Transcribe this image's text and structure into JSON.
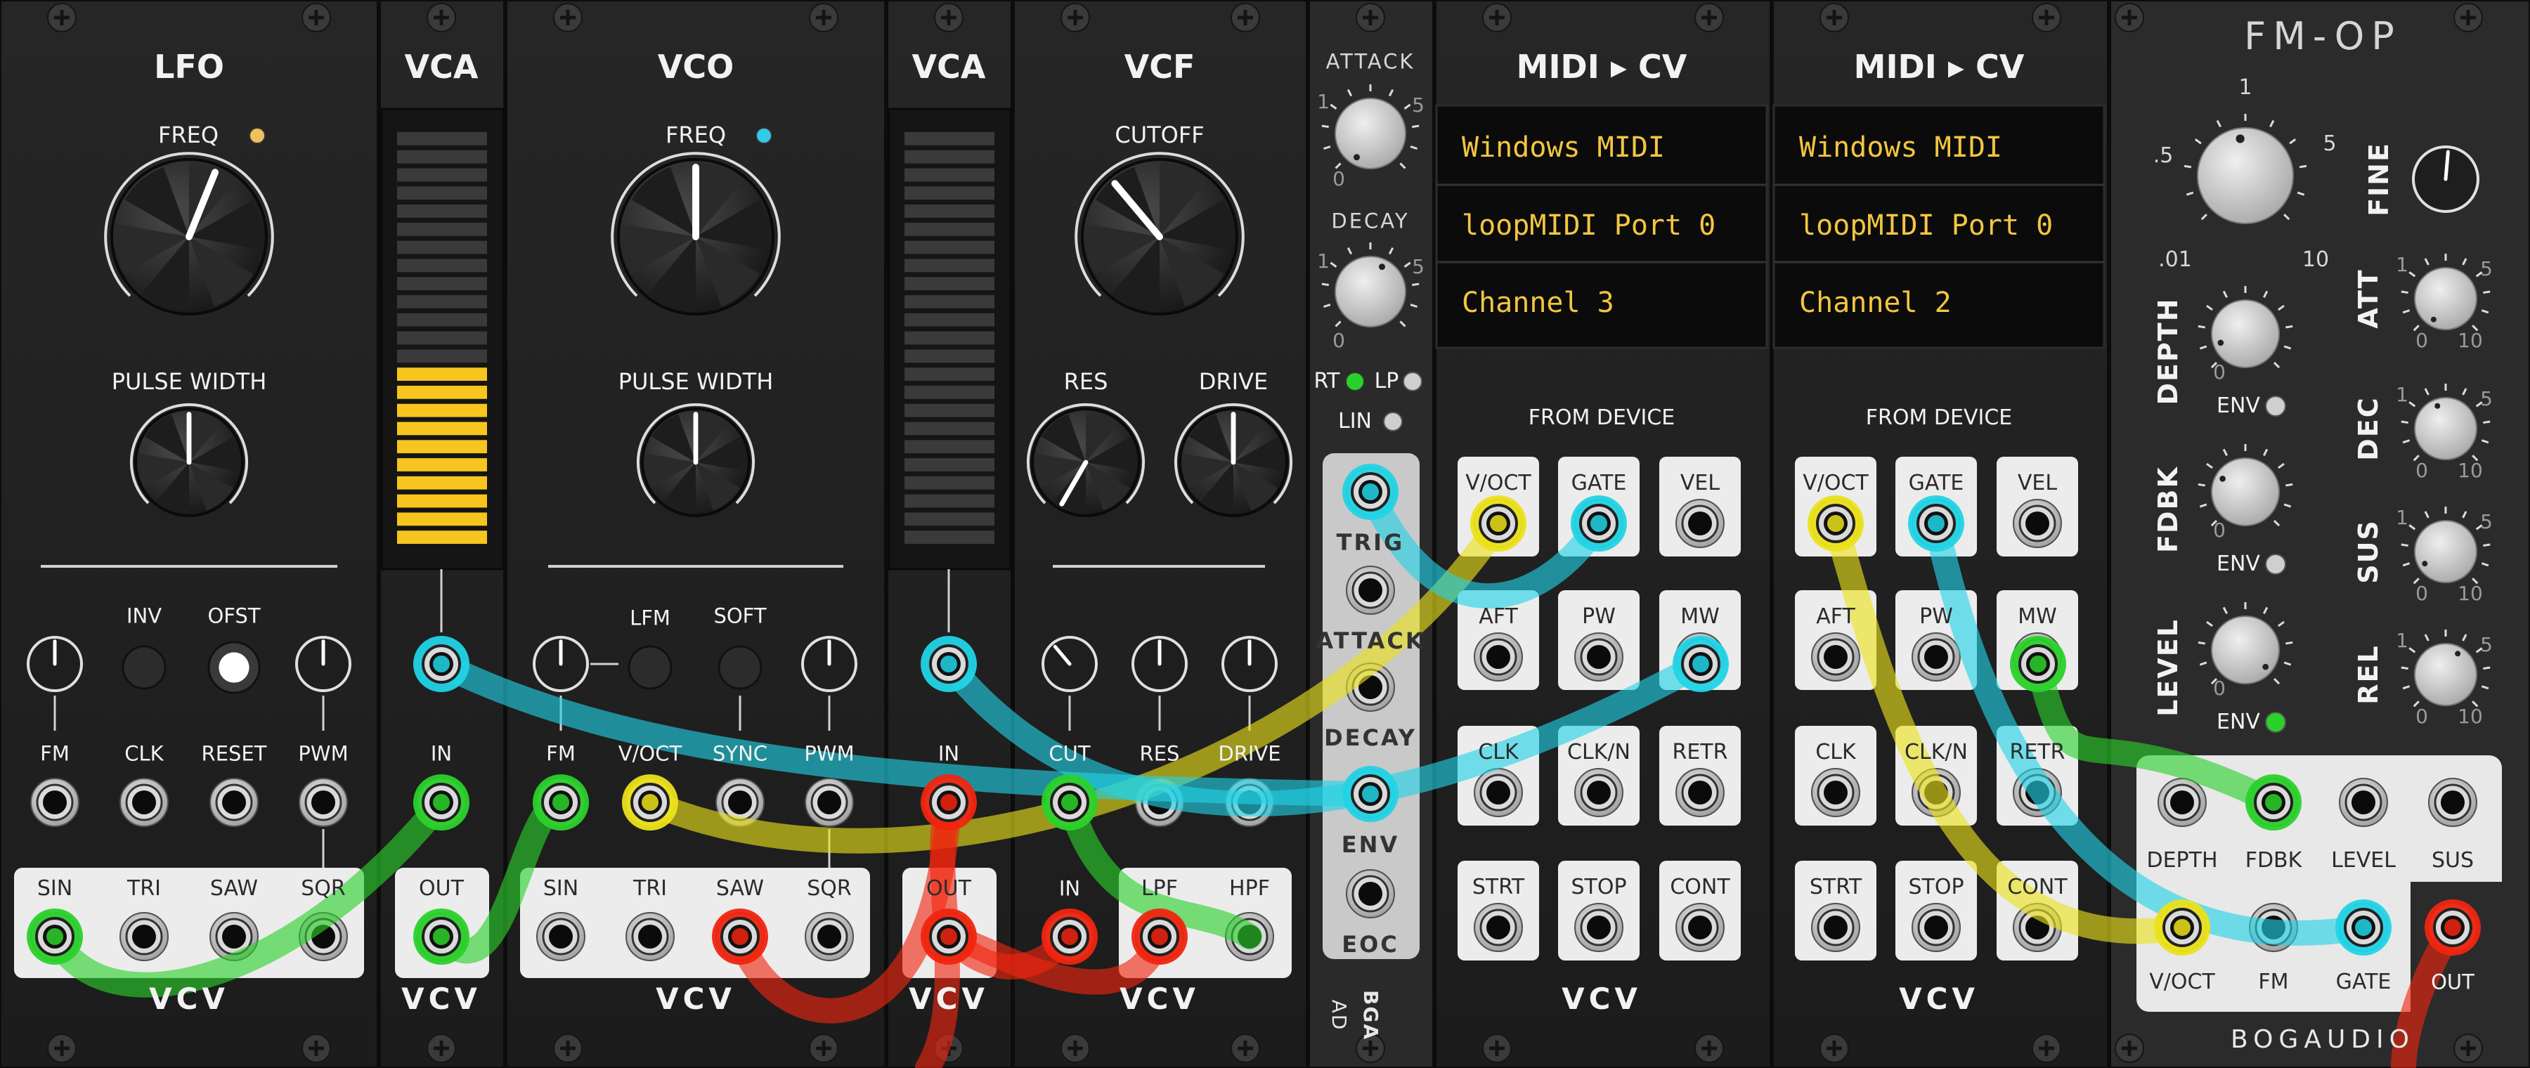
{
  "modules": {
    "lfo": {
      "title": "LFO",
      "freq_label": "FREQ",
      "pw_label": "PULSE WIDTH",
      "inv": "INV",
      "ofst": "OFST",
      "inputs": [
        "FM",
        "CLK",
        "RESET",
        "PWM"
      ],
      "outputs": [
        "SIN",
        "TRI",
        "SAW",
        "SQR"
      ],
      "freq_light_color": "#f0c060",
      "brand": "VCV"
    },
    "vca1": {
      "title": "VCA",
      "in": "IN",
      "out": "OUT",
      "brand": "VCV",
      "meter_color": "#f7c51e",
      "meter_level_pct": 45
    },
    "vco": {
      "title": "VCO",
      "freq_label": "FREQ",
      "pw_label": "PULSE WIDTH",
      "lfm": "LFM",
      "soft": "SOFT",
      "inputs": [
        "FM",
        "V/OCT",
        "SYNC",
        "PWM"
      ],
      "outputs": [
        "SIN",
        "TRI",
        "SAW",
        "SQR"
      ],
      "freq_light_color": "#35c9e8",
      "brand": "VCV"
    },
    "vca2": {
      "title": "VCA",
      "in": "IN",
      "out": "OUT",
      "brand": "VCV",
      "meter_level_pct": 0
    },
    "vcf": {
      "title": "VCF",
      "cutoff": "CUTOFF",
      "res": "RES",
      "drive": "DRIVE",
      "inputs": [
        "CUT",
        "RES",
        "DRIVE"
      ],
      "in": "IN",
      "outputs": [
        "LPF",
        "HPF"
      ],
      "brand": "VCV"
    },
    "ad": {
      "attack": "ATTACK",
      "decay": "DECAY",
      "scale": [
        "1",
        "5",
        "0"
      ],
      "rt": "RT",
      "lp": "LP",
      "lin": "LIN",
      "jacks": [
        "TRIG",
        "ATTACK",
        "DECAY",
        "ENV",
        "EOC"
      ],
      "name": "AD",
      "brand": "BGA"
    },
    "midi1": {
      "title": "MIDI ▸ CV",
      "driver": "Windows MIDI",
      "device": "loopMIDI Port 0",
      "channel": "Channel 3",
      "section": "FROM DEVICE",
      "outputs": [
        "V/OCT",
        "GATE",
        "VEL",
        "AFT",
        "PW",
        "MW",
        "CLK",
        "CLK/N",
        "RETR",
        "STRT",
        "STOP",
        "CONT"
      ],
      "brand": "VCV"
    },
    "midi2": {
      "title": "MIDI ▸ CV",
      "driver": "Windows MIDI",
      "device": "loopMIDI Port 0",
      "channel": "Channel 2",
      "section": "FROM DEVICE",
      "outputs": [
        "V/OCT",
        "GATE",
        "VEL",
        "AFT",
        "PW",
        "MW",
        "CLK",
        "CLK/N",
        "RETR",
        "STRT",
        "STOP",
        "CONT"
      ],
      "brand": "VCV"
    },
    "fmop": {
      "title": "FM-OP",
      "ratio_scale": [
        ".5",
        "1",
        "5",
        ".01",
        "10"
      ],
      "fine": "FINE",
      "depth": "DEPTH",
      "fdbk": "FDBK",
      "level": "LEVEL",
      "env": "ENV",
      "small_scale": [
        "0"
      ],
      "adsr": [
        "ATT",
        "DEC",
        "SUS",
        "REL"
      ],
      "adsr_scale": [
        "1",
        "5",
        "0",
        "10"
      ],
      "inputs_top": [
        "DEPTH",
        "FDBK",
        "LEVEL",
        "SUS"
      ],
      "inputs_bottom": [
        "V/OCT",
        "FM",
        "GATE",
        "OUT"
      ],
      "brand": "BOGAUDIO"
    }
  },
  "cable_colors": {
    "green": "#2bd12b",
    "yellow": "#ece21a",
    "cyan": "#22d4e6",
    "red": "#f0250f"
  }
}
